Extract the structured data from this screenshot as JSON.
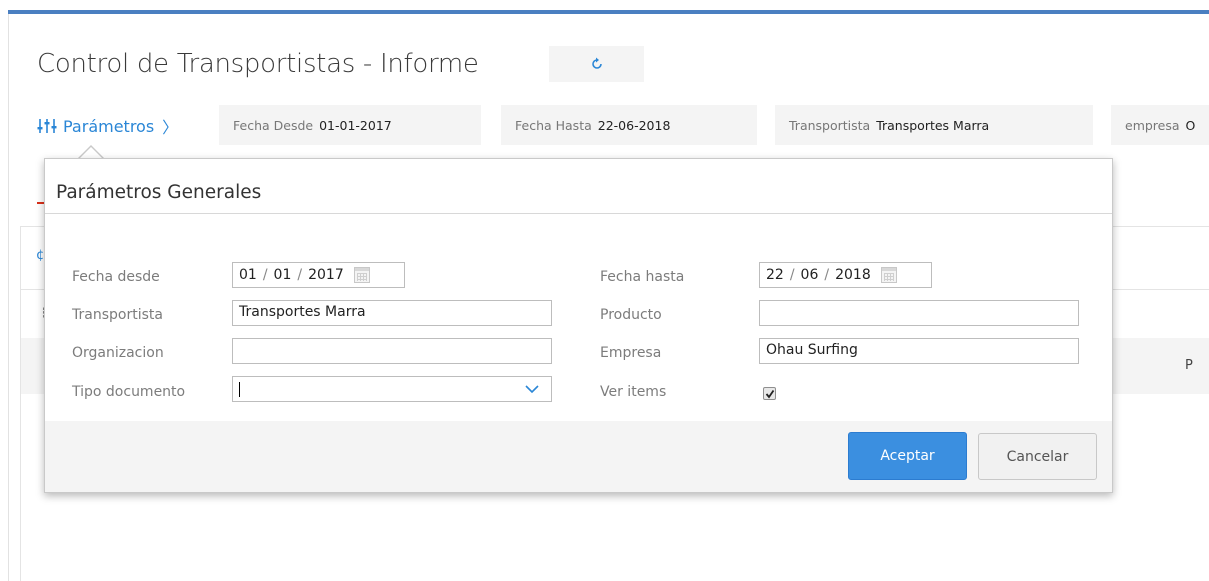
{
  "header": {
    "title": "Control de Transportistas - Informe",
    "refresh_icon": "refresh-icon"
  },
  "params_bar": {
    "toggle_label": "Parámetros",
    "toggle_chevron": "〉",
    "toggle_icon": "sliders-icon",
    "chips": [
      {
        "label": "Fecha Desde",
        "value": "01-01-2017"
      },
      {
        "label": "Fecha Hasta",
        "value": "22-06-2018"
      },
      {
        "label": "Transportista",
        "value": "Transportes Marra"
      },
      {
        "label": "empresa",
        "value": "O"
      }
    ]
  },
  "background": {
    "column_p": "P"
  },
  "modal": {
    "title": "Parámetros Generales",
    "fields": {
      "fecha_desde": {
        "label": "Fecha desde",
        "day": "01",
        "month": "01",
        "year": "2017",
        "sep": "/"
      },
      "fecha_hasta": {
        "label": "Fecha hasta",
        "day": "22",
        "month": "06",
        "year": "2018",
        "sep": "/"
      },
      "transportista": {
        "label": "Transportista",
        "value": "Transportes Marra"
      },
      "producto": {
        "label": "Producto",
        "value": ""
      },
      "organizacion": {
        "label": "Organizacion",
        "value": ""
      },
      "empresa": {
        "label": "Empresa",
        "value": "Ohau Surfing"
      },
      "tipo_documento": {
        "label": "Tipo documento",
        "value": ""
      },
      "ver_items": {
        "label": "Ver items",
        "checked": true
      }
    },
    "buttons": {
      "accept": "Aceptar",
      "cancel": "Cancelar"
    }
  },
  "colors": {
    "accent": "#2a86d6",
    "primary_button": "#3b8fe0",
    "top_bar": "#4a7fc1"
  }
}
